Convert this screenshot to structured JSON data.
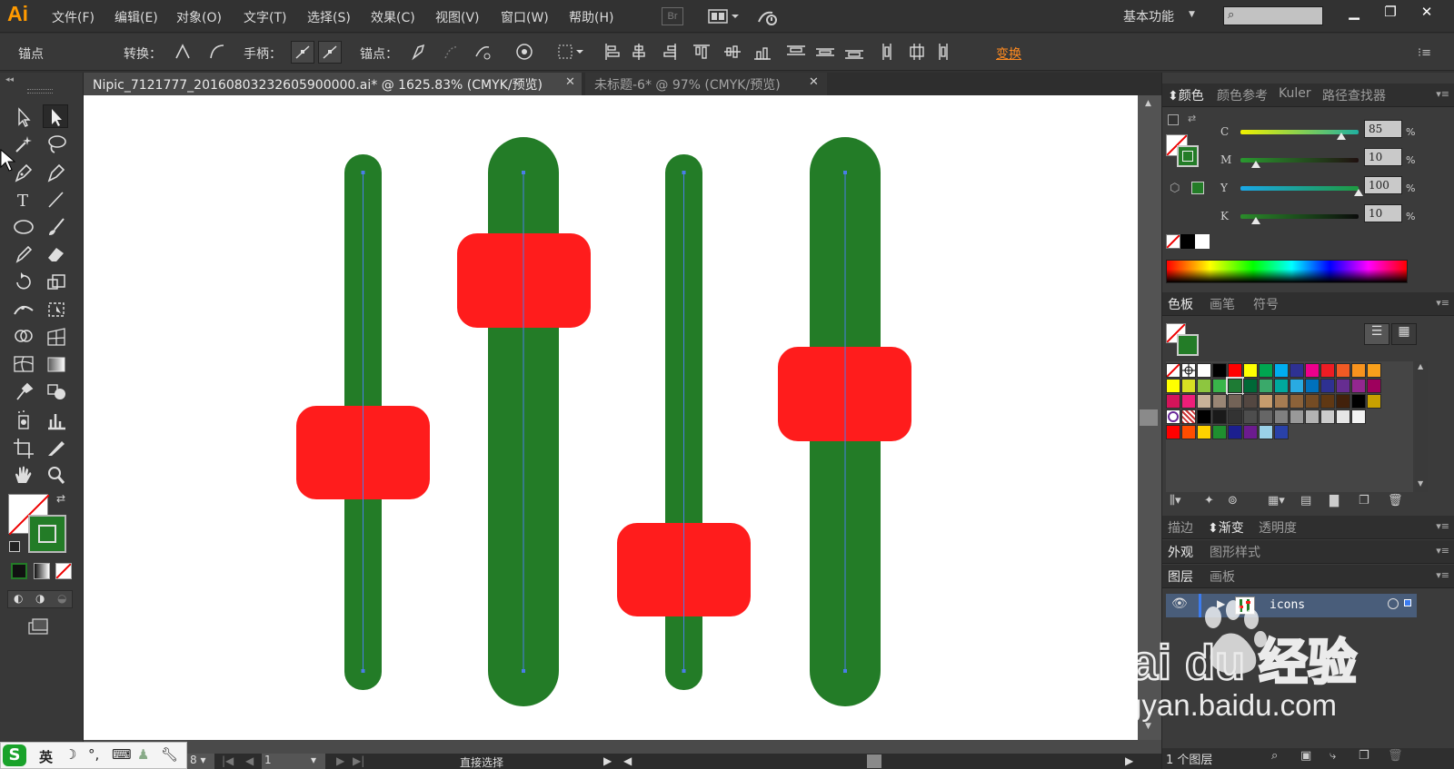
{
  "app": {
    "logo": "Ai"
  },
  "menu": {
    "items": [
      "文件(F)",
      "编辑(E)",
      "对象(O)",
      "文字(T)",
      "选择(S)",
      "效果(C)",
      "视图(V)",
      "窗口(W)",
      "帮助(H)"
    ],
    "bridge": "Br",
    "workspace": "基本功能",
    "window_buttons": [
      "minimize-icon",
      "restore-icon",
      "close-icon"
    ]
  },
  "controlbar": {
    "mode_label": "锚点",
    "convert_label": "转换：",
    "handles_label": "手柄：",
    "anchors_label": "锚点：",
    "transform_link": "变换"
  },
  "tabs": [
    {
      "title": "Nipic_7121777_20160803232605900000.ai* @ 1625.83% (CMYK/预览)",
      "active": true
    },
    {
      "title": "未标题-6* @ 97% (CMYK/预览)",
      "active": false
    }
  ],
  "statusbar": {
    "zoom": "8",
    "artboard": "1",
    "tool": "直接选择"
  },
  "ime": {
    "lang": "英"
  },
  "panels": {
    "color": {
      "tabs": [
        "颜色",
        "颜色参考",
        "Kuler",
        "路径查找器"
      ],
      "channels": [
        {
          "label": "C",
          "value": "85",
          "fraction": 0.85,
          "gradient": "linear-gradient(to right,#f0f000,#21b0a0)"
        },
        {
          "label": "M",
          "value": "10",
          "fraction": 0.1,
          "gradient": "linear-gradient(to right,#2a9a30,#201010)"
        },
        {
          "label": "Y",
          "value": "100",
          "fraction": 1.0,
          "gradient": "linear-gradient(to right,#1aa8e8,#1e9a40)"
        },
        {
          "label": "K",
          "value": "10",
          "fraction": 0.1,
          "gradient": "linear-gradient(to right,#2b8c2b,#0b0b0b)"
        }
      ],
      "unit": "%"
    },
    "swatches": {
      "tabs": [
        "色板",
        "画笔",
        "符号"
      ]
    },
    "stroke_group": {
      "tabs": [
        "描边",
        "渐变",
        "透明度"
      ]
    },
    "appearance_group": {
      "tabs": [
        "外观",
        "图形样式"
      ]
    },
    "layers": {
      "tabs": [
        "图层",
        "画板"
      ],
      "layer_name": "icons",
      "footer": "1 个图层"
    }
  },
  "colors": {
    "fill_green": "#237c27",
    "knob_red": "#ff1c1c",
    "accent_orange": "#ff8a1f",
    "guide_blue": "#4a7de8"
  },
  "watermark": {
    "brand": "Bai du 经验",
    "url": "jingyan.baidu.com"
  }
}
